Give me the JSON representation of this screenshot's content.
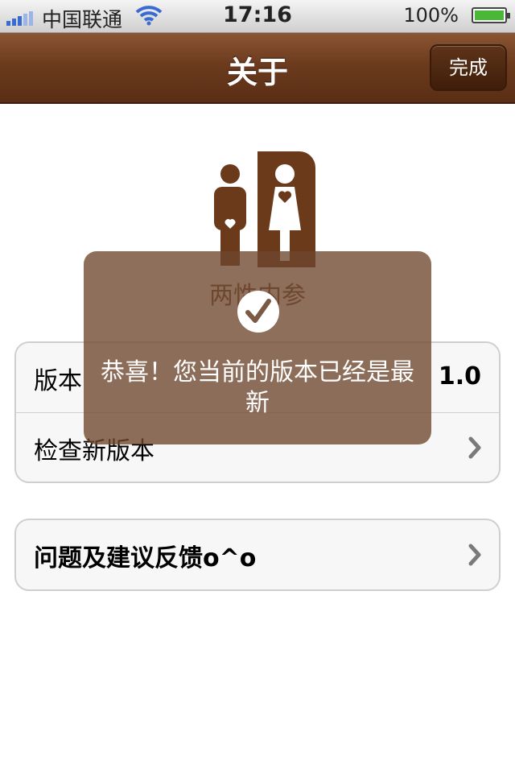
{
  "status_bar": {
    "carrier": "中国联通",
    "time": "17:16",
    "battery_percent": "100%"
  },
  "nav": {
    "title": "关于",
    "done_label": "完成"
  },
  "app": {
    "name": "两性内参"
  },
  "groups": [
    {
      "rows": [
        {
          "label": "版本",
          "value": "1.0"
        },
        {
          "label": "检查新版本",
          "accessory": "chevron-right-icon"
        }
      ]
    },
    {
      "rows": [
        {
          "label": "问题及建议反馈o^o",
          "accessory": "chevron-right-icon"
        }
      ]
    }
  ],
  "hud": {
    "message": "恭喜！您当前的版本已经是最新",
    "icon": "checkmark-icon"
  },
  "colors": {
    "nav_brown": "#6c3b1e",
    "logo_brown": "#6a3a1b",
    "hud_bg": "#6e462d"
  }
}
